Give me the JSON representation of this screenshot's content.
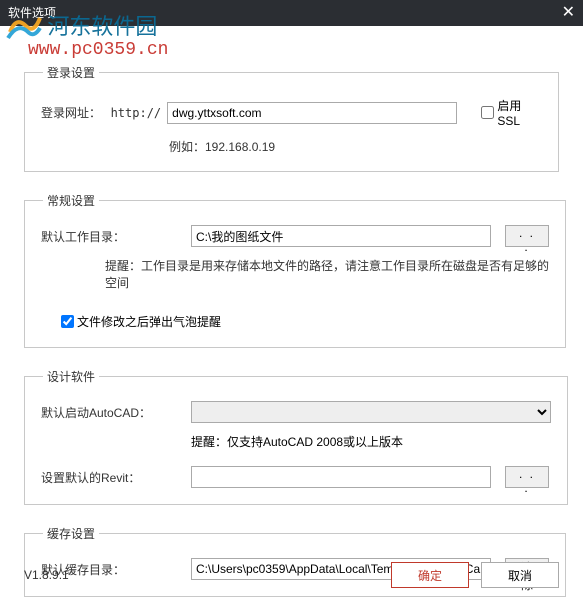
{
  "titlebar": {
    "title": "软件选项",
    "close": "✕"
  },
  "watermark": {
    "text1": "河东软件园",
    "text2": "www.pc0359.cn"
  },
  "login_section": {
    "legend": "登录设置",
    "url_label": "登录网址：",
    "http_prefix": "http://",
    "url_value": "dwg.yttxsoft.com",
    "ssl_label": "启用SSL",
    "ssl_checked": false,
    "example": "例如：192.168.0.19"
  },
  "general_section": {
    "legend": "常规设置",
    "workdir_label": "默认工作目录：",
    "workdir_value": "C:\\我的图纸文件",
    "browse_label": ". . .",
    "workdir_hint": "提醒：工作目录是用来存储本地文件的路径，请注意工作目录所在磁盘是否有足够的空间",
    "bubble_label": "文件修改之后弹出气泡提醒",
    "bubble_checked": true
  },
  "design_section": {
    "legend": "设计软件",
    "autocad_label": "默认启动AutoCAD：",
    "autocad_value": "",
    "autocad_hint": "提醒：仅支持AutoCAD 2008或以上版本",
    "revit_label": "设置默认的Revit：",
    "revit_value": "",
    "browse_label": ". . ."
  },
  "cache_section": {
    "legend": "缓存设置",
    "cachedir_label": "默认缓存目录：",
    "cachedir_value": "C:\\Users\\pc0359\\AppData\\Local\\Temp\\DesignPlat\\Ca",
    "clear_label": "清除"
  },
  "footer": {
    "version": "V1.8.9.1",
    "ok": "确定",
    "cancel": "取消"
  }
}
